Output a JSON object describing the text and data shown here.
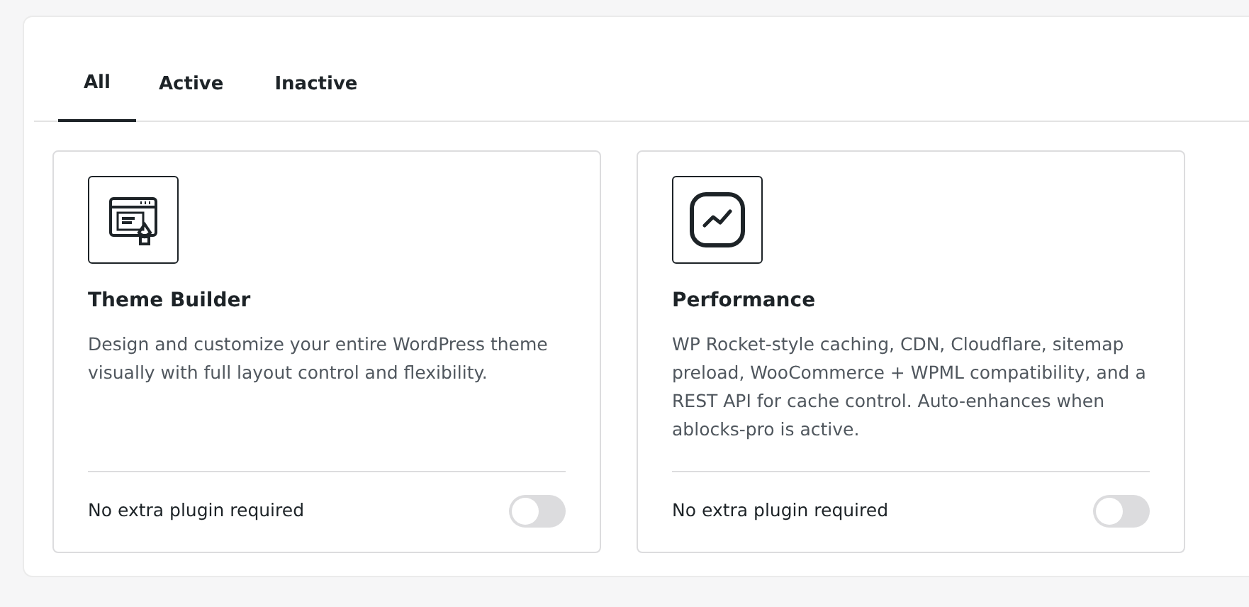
{
  "tabs": [
    {
      "label": "All",
      "selected": true
    },
    {
      "label": "Active",
      "selected": false
    },
    {
      "label": "Inactive",
      "selected": false
    }
  ],
  "modules": [
    {
      "kind": "theme-builder",
      "title": "Theme Builder",
      "description": "Design and customize your entire WordPress theme visually with full layout control and flexibility.",
      "footer": "No extra plugin required",
      "on": false
    },
    {
      "kind": "performance",
      "title": "Performance",
      "description": "WP Rocket-style caching, CDN, Cloudflare, sitemap preload, WooCommerce + WPML compatibility, and a REST API for cache control. Auto-enhances when ablocks-pro is active.",
      "footer": "No extra plugin required",
      "on": false
    }
  ]
}
